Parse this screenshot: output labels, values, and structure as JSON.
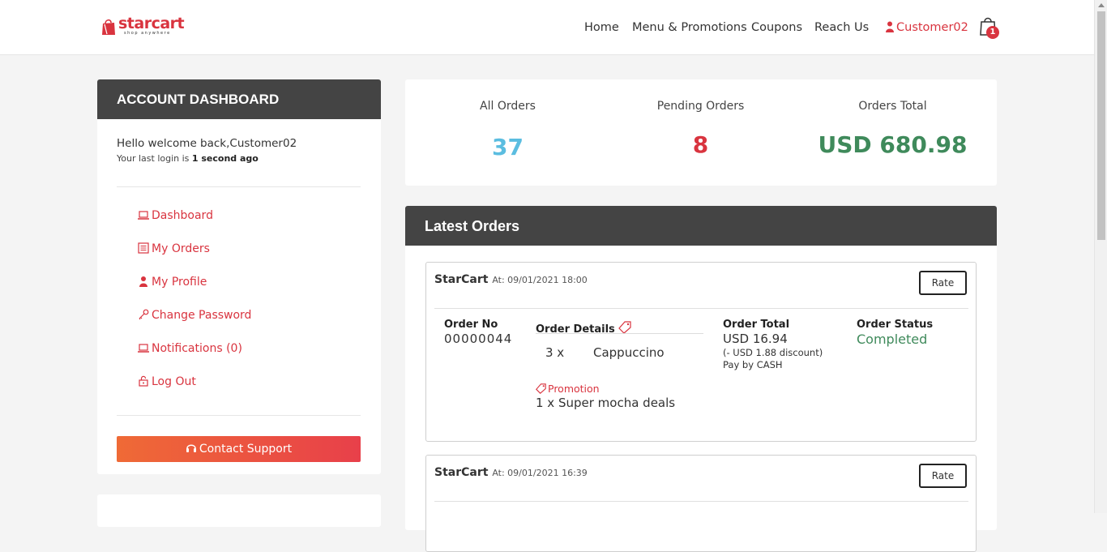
{
  "brand": {
    "name": "starcart",
    "tagline": "shop anywhere",
    "accent": "#d9343f"
  },
  "nav": {
    "items": [
      "Home",
      "Menu & Promotions",
      "Coupons",
      "Reach Us"
    ],
    "user": "Customer02",
    "cart_count": "1"
  },
  "sidebar": {
    "title": "ACCOUNT DASHBOARD",
    "welcome": "Hello welcome back,Customer02",
    "last_login_prefix": "Your last login is",
    "last_login_value": "1 second ago",
    "menu": [
      {
        "label": "Dashboard",
        "icon": "laptop-icon"
      },
      {
        "label": "My Orders",
        "icon": "list-icon"
      },
      {
        "label": "My Profile",
        "icon": "user-icon"
      },
      {
        "label": "Change Password",
        "icon": "key-icon"
      },
      {
        "label": "Notifications (0)",
        "icon": "laptop-icon"
      },
      {
        "label": "Log Out",
        "icon": "lock-icon"
      }
    ],
    "support_button": "Contact Support"
  },
  "stats": [
    {
      "label": "All Orders",
      "value": "37",
      "color": "#5bbde0"
    },
    {
      "label": "Pending Orders",
      "value": "8",
      "color": "#d9343f"
    },
    {
      "label": "Orders Total",
      "value": "USD 680.98",
      "color": "#3f8a5b"
    }
  ],
  "orders": {
    "title": "Latest Orders",
    "columns": {
      "order_no": "Order No",
      "details": "Order Details",
      "total": "Order Total",
      "status": "Order Status"
    },
    "list": [
      {
        "shop": "StarCart",
        "at": "At: 09/01/2021 18:00",
        "rate_label": "Rate",
        "order_no": "00000044",
        "item_qty": "3 x",
        "item_name": "Cappuccino",
        "promotion_label": "Promotion",
        "promotion_item": "1 x Super mocha deals",
        "total": "USD 16.94",
        "discount": "(- USD 1.88 discount)",
        "payment": "Pay by CASH",
        "status": "Completed"
      },
      {
        "shop": "StarCart",
        "at": "At: 09/01/2021 16:39",
        "rate_label": "Rate"
      }
    ]
  }
}
